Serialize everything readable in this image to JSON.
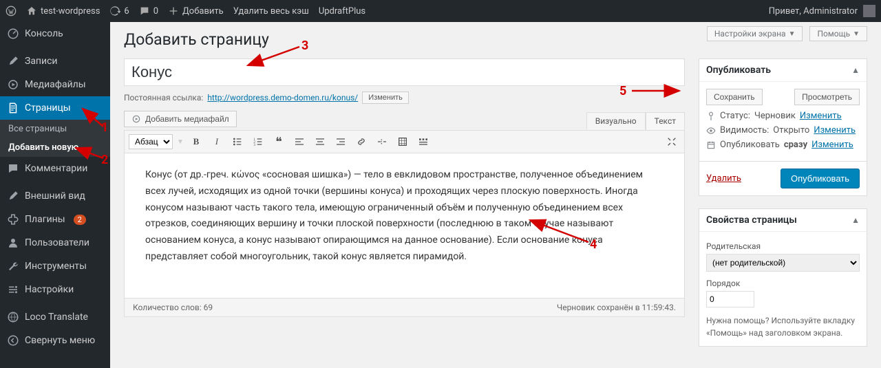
{
  "adminbar": {
    "site_name": "test-wordpress",
    "updates": "6",
    "comments": "0",
    "add_new": "Добавить",
    "clear_cache": "Удалить весь кэш",
    "updraft": "UpdraftPlus",
    "howdy": "Привет, Administrator"
  },
  "sidebar": {
    "console": "Консоль",
    "posts": "Записи",
    "media": "Медиафайлы",
    "pages": "Страницы",
    "pages_all": "Все страницы",
    "pages_add": "Добавить новую",
    "comments": "Комментарии",
    "appearance": "Внешний вид",
    "plugins": "Плагины",
    "plugins_badge": "2",
    "users": "Пользователи",
    "tools": "Инструменты",
    "settings": "Настройки",
    "loco": "Loco Translate",
    "collapse": "Свернуть меню"
  },
  "top": {
    "screen_options": "Настройки экрана",
    "help": "Помощь"
  },
  "page": {
    "heading": "Добавить страницу",
    "title_value": "Конус",
    "permalink_label": "Постоянная ссылка:",
    "permalink_url": "http://wordpress.demo-domen.ru/konus/",
    "permalink_edit": "Изменить",
    "add_media": "Добавить медиафайл",
    "tab_visual": "Визуально",
    "tab_text": "Текст",
    "format_select": "Абзац",
    "body": "Конус (от др.-греч. κώνος «сосновая шишка») — тело в евклидовом пространстве, полученное объединением всех лучей, исходящих из одной точки (вершины конуса) и проходящих через плоскую поверхность. Иногда конусом называют часть такого тела, имеющую ограниченный объём и полученную объединением всех отрезков, соединяющих вершину и точки плоской поверхности (последнюю в таком случае называют основанием конуса, а конус называют опирающимся на данное основание). Если основание конуса представляет собой многоугольник, такой конус является пирамидой.",
    "wordcount_label": "Количество слов:",
    "wordcount": "69",
    "draft_saved": "Черновик сохранён в 11:59:43."
  },
  "publish": {
    "title": "Опубликовать",
    "save": "Сохранить",
    "preview": "Просмотреть",
    "status_label": "Статус:",
    "status_value": "Черновик",
    "visibility_label": "Видимость:",
    "visibility_value": "Открыто",
    "schedule_label": "Опубликовать",
    "schedule_value": "сразу",
    "edit": "Изменить",
    "delete": "Удалить",
    "publish_btn": "Опубликовать"
  },
  "attrs": {
    "title": "Свойства страницы",
    "parent_label": "Родительская",
    "parent_value": "(нет родительской)",
    "order_label": "Порядок",
    "order_value": "0",
    "help": "Нужна помощь? Используйте вкладку «Помощь» над заголовком экрана."
  },
  "annotations": {
    "a1": "1",
    "a2": "2",
    "a3": "3",
    "a4": "4",
    "a5": "5"
  }
}
